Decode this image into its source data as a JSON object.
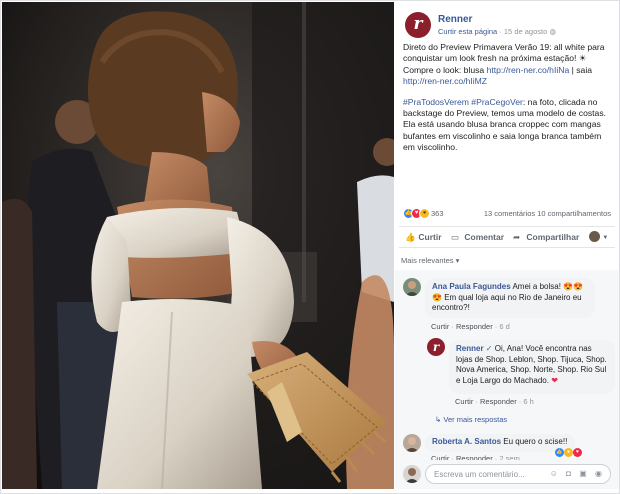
{
  "colors": {
    "brand": "#8b1f2c",
    "link": "#385898",
    "muted": "#90949c",
    "like": "#2d88ff",
    "love": "#f0284a"
  },
  "photo": {
    "description_icon": "photo-of-model-backstage"
  },
  "post": {
    "page_logo_letter": "r",
    "page_name": "Renner",
    "follow_link": "Curtir esta página",
    "separator": "·",
    "date": "15 de agosto",
    "privacy_icon": "globe-icon",
    "paragraph1_lead": "Direto do Preview Primavera Verão 19: all white para conquistar um look fresh na próxima estação!",
    "paragraph1_emoji": "☀",
    "paragraph1_mid": " Compre o look: blusa ",
    "link1": "http://ren-ner.co/hIiNa",
    "paragraph1_sep": " | saia ",
    "link2": "http://ren-ner.co/hIiMZ",
    "paragraph2_tags": "#PraTodosVerem #PraCegoVer",
    "paragraph2_rest": ": na foto, clicada no backstage do Preview, temos uma modelo de costas. Ela está usando blusa branca croppec com mangas bufantes em viscolinho e saia longa branca também em viscolinho."
  },
  "stats": {
    "reactions_count": "363",
    "comments_shares": "13 comentários  10 compartilhamentos"
  },
  "actions": {
    "like": "Curtir",
    "comment": "Comentar",
    "share": "Compartilhar",
    "like_icon": "thumbs-up-icon",
    "comment_icon": "speech-bubble-icon",
    "share_icon": "share-arrow-icon"
  },
  "relevant_label": "Mais relevantes ▾",
  "comments": [
    {
      "author": "Ana Paula Fagundes",
      "text_1": " Amei a bolsa!",
      "emoji_1": "😍😍",
      "text_2": " Em qual loja aqui no Rio de Janeiro eu encontro?!",
      "emoji_2": "😍",
      "like": "Curtir",
      "reply": "Responder",
      "age": "6 d"
    },
    {
      "author": "Renner",
      "verified": "✓",
      "text": " Oi, Ana! Você encontra nas lojas de Shop. Leblon, Shop. Tijuca, Shop. Nova America, Shop. Norte, Shop. Rio Sul e Loja Largo do Machado.",
      "heart": "❤",
      "like": "Curtir",
      "reply": "Responder",
      "age": "6 h"
    },
    {
      "author": "Roberta A. Santos",
      "text": " Eu quero o scise!!",
      "reaction_count": "4",
      "like": "Curtir",
      "reply": "Responder",
      "age": "2 sem"
    }
  ],
  "more_replies": "↳  Ver mais respostas",
  "write": {
    "placeholder": "Escreva um comentário...",
    "icons": "☺ ◘ ▣ ◉"
  }
}
